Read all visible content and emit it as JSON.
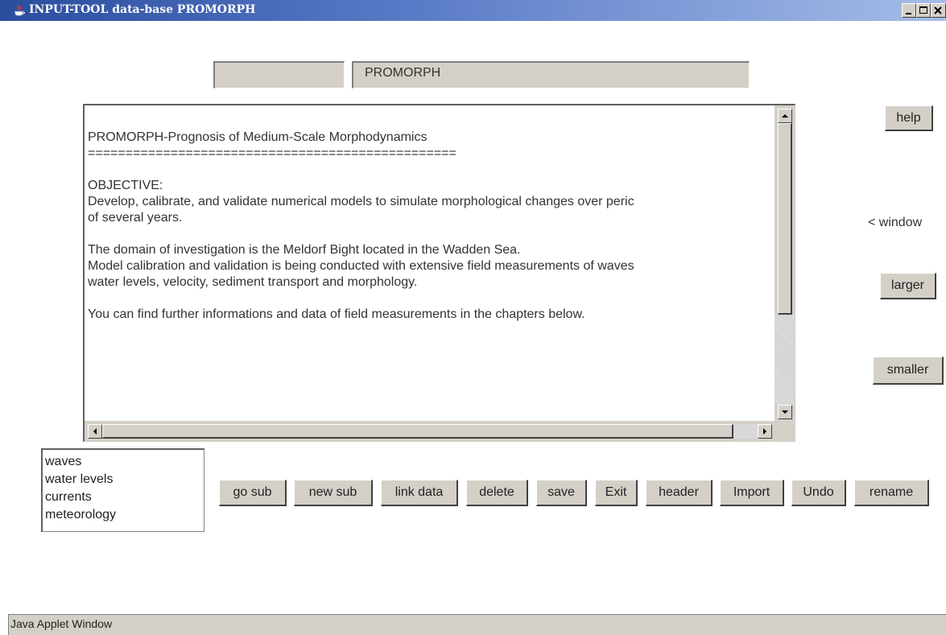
{
  "window": {
    "title": "INPUT-TOOL data-base PROMORPH",
    "icon": "java-coffee-icon",
    "controls": [
      "minimize-icon",
      "maximize-icon",
      "close-icon"
    ]
  },
  "header": {
    "left_field_value": "",
    "name_field_value": "PROMORPH"
  },
  "textarea": {
    "lines": [
      "PROMORPH-Prognosis of Medium-Scale Morphodynamics",
      "=================================================",
      "",
      "OBJECTIVE:",
      "Develop, calibrate, and validate numerical models to simulate morphological changes over peric",
      "of several years.",
      "",
      "The domain of investigation is the Meldorf Bight located in the Wadden Sea.",
      "Model calibration and validation is being conducted with extensive field measurements of waves",
      "water levels, velocity, sediment transport and morphology.",
      "",
      "You can find further informations and data of field measurements in the chapters below."
    ]
  },
  "side": {
    "help_label": "help",
    "window_label": "< window",
    "larger_label": "larger",
    "smaller_label": "smaller"
  },
  "list": {
    "items": [
      "waves",
      "water levels",
      "currents",
      "meteorology"
    ]
  },
  "toolbar": {
    "buttons": [
      "go sub",
      "new sub",
      "link data",
      "delete",
      "save",
      "Exit",
      "header",
      "Import",
      "Undo",
      "rename"
    ]
  },
  "status": {
    "text": "Java Applet Window"
  },
  "colors": {
    "titlebar_start": "#2a4d9e",
    "titlebar_end": "#a6bde8",
    "panel": "#d4d0c8"
  }
}
